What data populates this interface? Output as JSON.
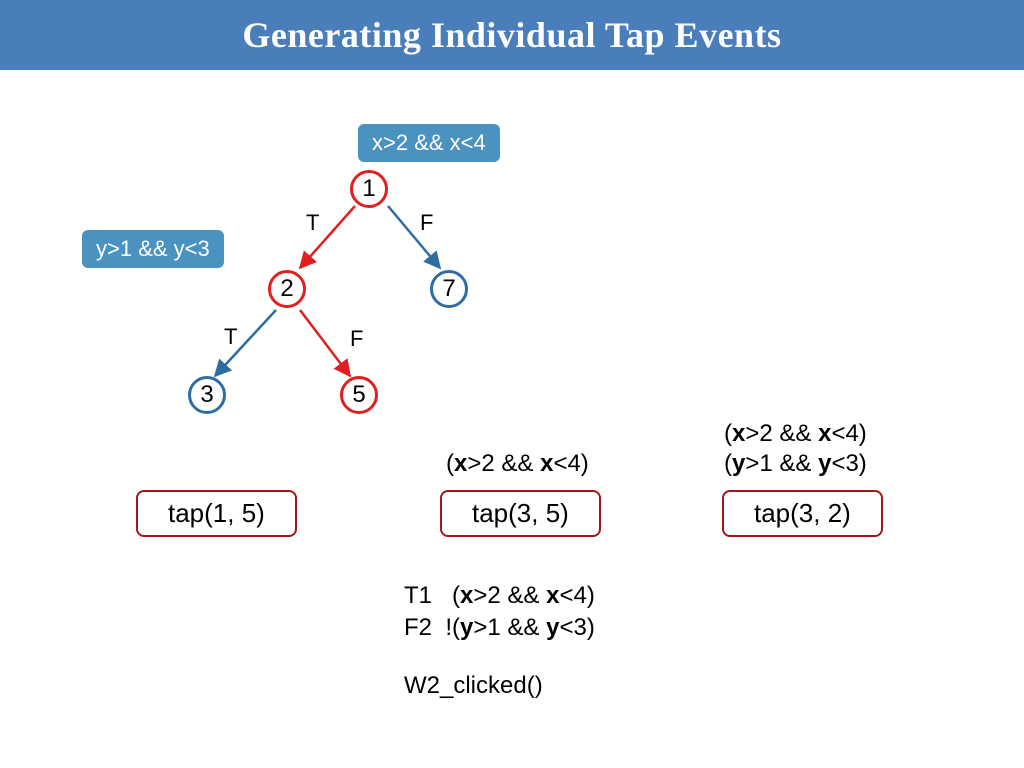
{
  "title": "Generating Individual Tap Events",
  "tags": {
    "x": "x>2 && x<4",
    "y": "y>1 && y<3"
  },
  "nodes": {
    "n1": "1",
    "n2": "2",
    "n3": "3",
    "n5": "5",
    "n7": "7"
  },
  "labels": {
    "t1": "T",
    "f1": "F",
    "t2": "T",
    "f2": "F"
  },
  "taps": {
    "a": "tap(1, 5)",
    "b": "tap(3, 5)",
    "c": "tap(3, 2)"
  },
  "constraints": {
    "line1_html": "(<b>x</b>>2 && <b>x</b><4)",
    "line2_html": "(<b>y</b>>1 && <b>y</b><3)",
    "t1_html": "T1&nbsp;&nbsp;&nbsp;(<b>x</b>>2 && <b>x</b><4)",
    "f2_html": "F2&nbsp;&nbsp;!(<b>y</b>>1 && <b>y</b><3)",
    "wclick": "W2_clicked()"
  }
}
